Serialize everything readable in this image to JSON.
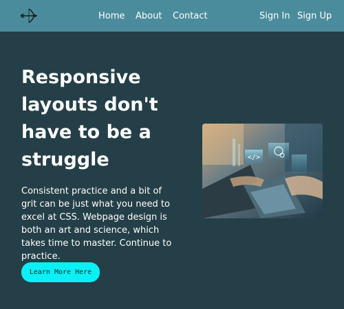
{
  "nav": {
    "logo_icon": "bow-and-arrow-icon",
    "links": [
      "Home",
      "About",
      "Contact"
    ],
    "auth": [
      "Sign In",
      "Sign Up"
    ]
  },
  "hero": {
    "title": "Responsive layouts don't have to be a struggle",
    "body": "Consistent practice and a bit of grit can be just what you need to excel at CSS. Webpage design is both an art and science, which takes time to master. Continue to practice.",
    "cta_label": "Learn More Here",
    "image_icon": "laptop-coding-photo"
  },
  "colors": {
    "background": "#243f47",
    "navbar": "#4b8c9c",
    "cta": "#0af0f5"
  }
}
